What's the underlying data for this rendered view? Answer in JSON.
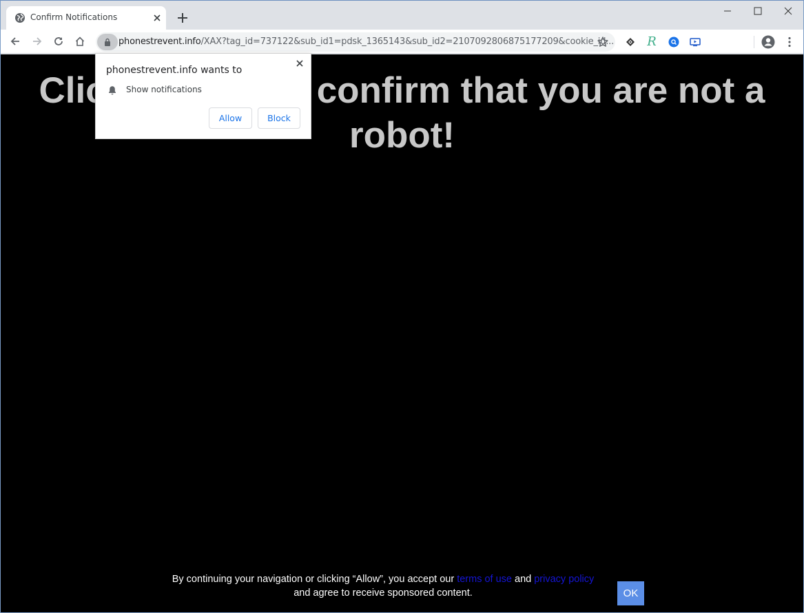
{
  "browser": {
    "tab": {
      "title": "Confirm Notifications",
      "favicon": "globe-icon"
    },
    "new_tab_icon": "plus-icon",
    "window_controls": [
      "minimize-icon",
      "maximize-icon",
      "close-icon"
    ],
    "nav": {
      "back_icon": "arrow-left-icon",
      "forward_icon": "arrow-right-icon",
      "reload_icon": "reload-icon",
      "home_icon": "home-icon"
    },
    "address_bar": {
      "host": "phonestrevent.info",
      "path": "/XAX?tag_id=737122&sub_id1=pdsk_1365143&sub_id2=2107092806875177209&cookie_id...",
      "lock_icon": "lock-icon",
      "bookmark_icon": "star-icon"
    },
    "extensions": [
      "extension-diamond-icon",
      "extension-r-icon",
      "extension-search-icon",
      "extension-media-icon"
    ],
    "profile_icon": "account-circle-icon",
    "menu_icon": "kebab-menu-icon"
  },
  "permission_popup": {
    "title": "phonestrevent.info wants to",
    "permission": "Show notifications",
    "allow_label": "Allow",
    "block_label": "Block"
  },
  "page": {
    "headline": "Click Allow to confirm that you are not a robot!",
    "headline_visible_left": "Clic",
    "headline_visible_right": "confirm that you are not a",
    "headline_line2": "robot!",
    "footer": {
      "text_before": "By continuing your navigation or clicking “Allow”, you accept our ",
      "terms_link": "terms of use",
      "and_1": " and ",
      "privacy_link": "privacy policy",
      "text_after": " and agree to receive sponsored content.",
      "ok_label": "OK"
    },
    "colors": {
      "background": "#000000",
      "headline": "#c8c8c8",
      "link": "#1515d6",
      "ok_button": "#5b8ee6",
      "popup_button_text": "#1a73e8"
    }
  }
}
